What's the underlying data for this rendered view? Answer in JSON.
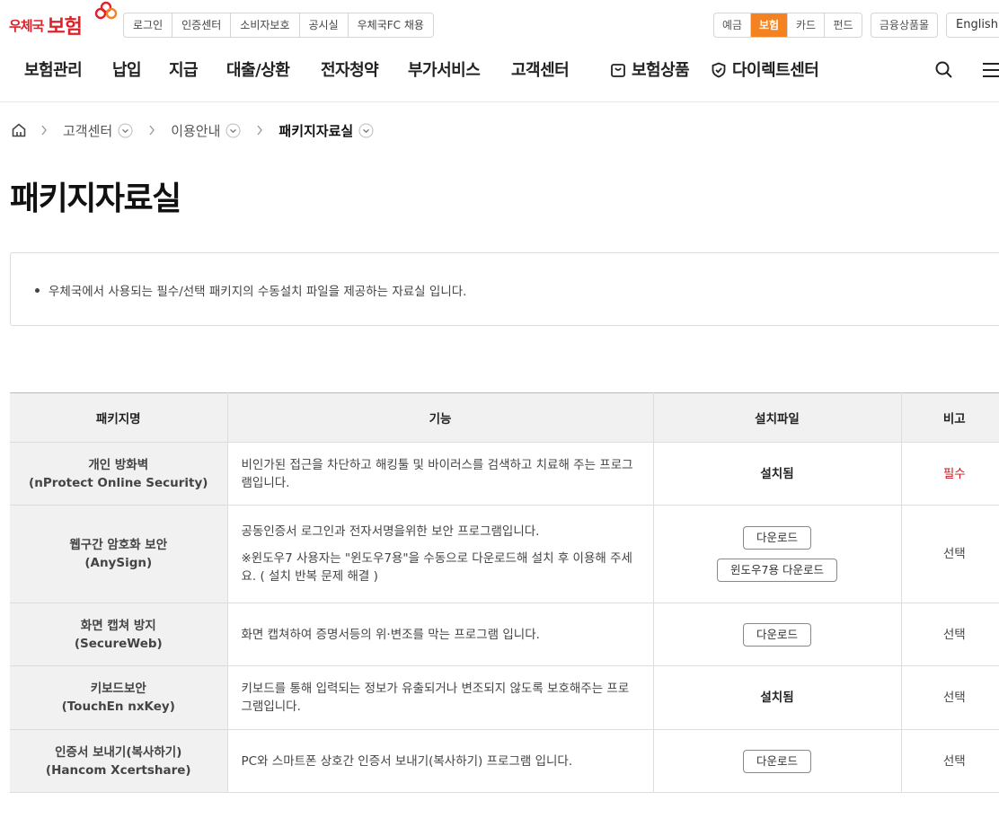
{
  "logo": {
    "small": "우체국",
    "big": "보험"
  },
  "util_links": [
    "로그인",
    "인증센터",
    "소비자보호",
    "공시실",
    "우체국FC 채용"
  ],
  "biz_tabs": [
    {
      "label": "예금",
      "active": false
    },
    {
      "label": "보험",
      "active": true
    },
    {
      "label": "카드",
      "active": false
    },
    {
      "label": "펀드",
      "active": false
    }
  ],
  "fin_products": "금융상품몰",
  "english": "English",
  "gnb": {
    "items": [
      "보험관리",
      "납입",
      "지급",
      "대출/상환",
      "전자청약",
      "부가서비스",
      "고객센터"
    ],
    "insurance_products": "보험상품",
    "direct_center": "다이렉트센터"
  },
  "breadcrumb": {
    "items": [
      "고객센터",
      "이용안내",
      "패키지자료실"
    ]
  },
  "page_title": "패키지자료실",
  "notice": "우체국에서 사용되는 필수/선택 패키지의 수동설치 파일을 제공하는 자료실 입니다.",
  "table": {
    "headers": [
      "패키지명",
      "기능",
      "설치파일",
      "비고"
    ],
    "rows": [
      {
        "name1": "개인 방화벽",
        "name2": "(nProtect Online Security)",
        "func1": "비인가된 접근을 차단하고 해킹툴 및 바이러스를 검색하고 치료해 주는 프로그램입니다.",
        "func2": "",
        "installed": "설치됨",
        "note": "필수"
      },
      {
        "name1": "웹구간 암호화 보안",
        "name2": "(AnySign)",
        "func1": "공동인증서 로그인과 전자서명을위한 보안 프로그램입니다.",
        "func2": "※윈도우7 사용자는 \"윈도우7용\"을 수동으로 다운로드해 설치 후 이용해 주세요. ( 설치 반복 문제 해결 )",
        "download": "다운로드",
        "download_win7": "윈도우7용 다운로드",
        "note": "선택"
      },
      {
        "name1": "화면 캡쳐 방지",
        "name2": "(SecureWeb)",
        "func1": "화면 캡쳐하여 증명서등의 위·변조를 막는 프로그램 입니다.",
        "download": "다운로드",
        "note": "선택"
      },
      {
        "name1": "키보드보안",
        "name2": "(TouchEn nxKey)",
        "func1": "키보드를 통해 입력되는 정보가 유출되거나 변조되지 않도록 보호해주는 프로그램입니다.",
        "installed": "설치됨",
        "note": "선택"
      },
      {
        "name1": "인증서 보내기(복사하기)",
        "name2": "(Hancom Xcertshare)",
        "func1": "PC와 스마트폰 상호간 인증서 보내기(복사하기) 프로그램 입니다.",
        "download": "다운로드",
        "note": "선택"
      }
    ]
  },
  "colors": {
    "brand_red": "#e0212a",
    "active_orange": "#f58220",
    "required_red": "#c8161d"
  }
}
